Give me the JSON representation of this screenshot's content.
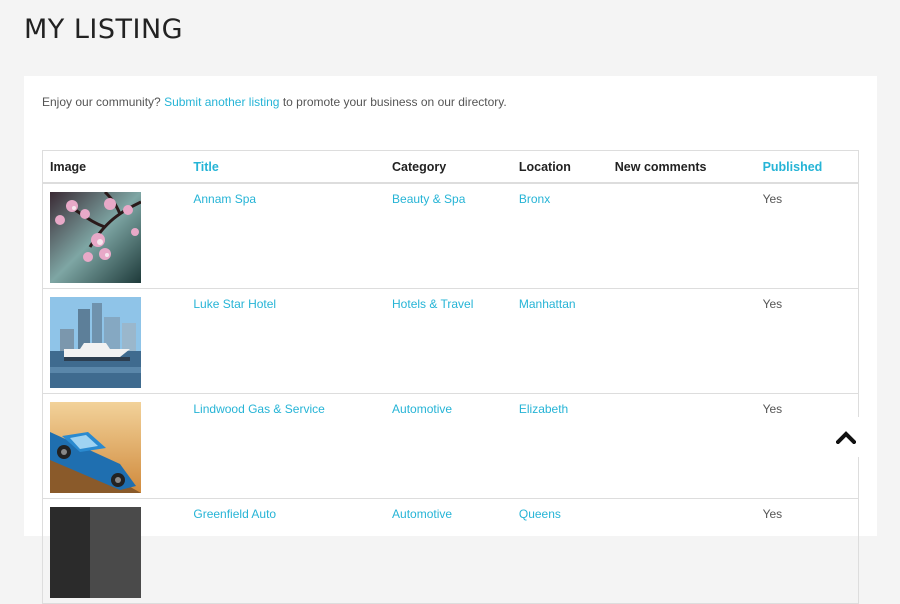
{
  "page": {
    "title": "MY LISTING"
  },
  "intro": {
    "prefix": "Enjoy our community?",
    "link": "Submit another listing",
    "suffix": "to promote your business on our directory."
  },
  "table": {
    "columns": {
      "image": "Image",
      "title": "Title",
      "category": "Category",
      "location": "Location",
      "comments": "New comments",
      "published": "Published"
    },
    "rows": [
      {
        "title": "Annam Spa",
        "category": "Beauty & Spa",
        "location": "Bronx",
        "comments": "",
        "published": "Yes",
        "image_icon": "cherry-blossom-photo"
      },
      {
        "title": "Luke Star Hotel",
        "category": "Hotels & Travel",
        "location": "Manhattan",
        "comments": "",
        "published": "Yes",
        "image_icon": "harbor-yacht-photo"
      },
      {
        "title": "Lindwood Gas & Service",
        "category": "Automotive",
        "location": "Elizabeth",
        "comments": "",
        "published": "Yes",
        "image_icon": "blue-classic-car-photo"
      },
      {
        "title": "Greenfield Auto",
        "category": "Automotive",
        "location": "Queens",
        "comments": "",
        "published": "Yes",
        "image_icon": "dark-photo"
      }
    ]
  },
  "colors": {
    "link": "#26b4d6",
    "background": "#f4f4f4"
  },
  "scroll_top": {
    "icon": "chevron-up-icon"
  }
}
